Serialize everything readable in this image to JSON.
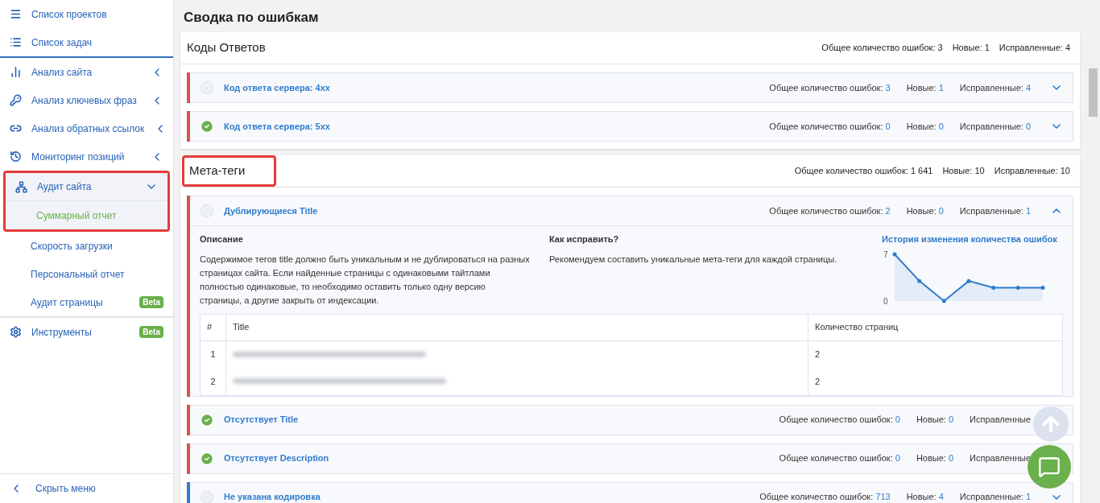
{
  "sidebar": {
    "top_items": [
      {
        "label": "Список проектов"
      },
      {
        "label": "Список задач"
      }
    ],
    "items": [
      {
        "label": "Анализ сайта",
        "expanded": false,
        "highlighted": false
      },
      {
        "label": "Анализ ключевых фраз",
        "expanded": false,
        "highlighted": false
      },
      {
        "label": "Анализ обратных ссылок",
        "expanded": false,
        "highlighted": false
      },
      {
        "label": "Мониторинг позиций",
        "expanded": false,
        "highlighted": false
      },
      {
        "label": "Аудит сайта",
        "expanded": true,
        "highlighted": true,
        "children": [
          {
            "label": "Суммарный отчет",
            "selected": true,
            "highlighted": true
          },
          {
            "label": "Скорость загрузки",
            "selected": false,
            "highlighted": false
          },
          {
            "label": "Персональный отчет",
            "selected": false,
            "highlighted": false
          },
          {
            "label": "Аудит страницы",
            "selected": false,
            "highlighted": false,
            "badge": "Beta"
          }
        ]
      },
      {
        "label": "Инструменты",
        "highlighted": false,
        "badge": "Beta"
      }
    ],
    "hide_menu": "Скрыть меню"
  },
  "page_title": "Сводка по ошибкам",
  "sections": [
    {
      "title": "Коды Ответов",
      "highlighted": false,
      "total_label": "Общее количество ошибок:",
      "total": "3",
      "new_label": "Новые:",
      "new": "1",
      "fixed_label": "Исправленные:",
      "fixed": "4",
      "rows": [
        {
          "resolved": false,
          "color": "#d9534f",
          "title": "Код ответа сервера: 4xx",
          "total_label": "Общее количество ошибок:",
          "total": "3",
          "new_label": "Новые:",
          "new": "1",
          "fixed_label": "Исправленные:",
          "fixed": "4",
          "expanded": false
        },
        {
          "resolved": true,
          "color": "#d9534f",
          "title": "Код ответа сервера: 5xx",
          "total_label": "Общее количество ошибок:",
          "total": "0",
          "new_label": "Новые:",
          "new": "0",
          "fixed_label": "Исправленные:",
          "fixed": "0",
          "expanded": false
        }
      ]
    },
    {
      "title": "Мета-теги",
      "highlighted": true,
      "total_label": "Общее количество ошибок:",
      "total": "1 641",
      "new_label": "Новые:",
      "new": "10",
      "fixed_label": "Исправленные:",
      "fixed": "10",
      "rows": [
        {
          "resolved": false,
          "color": "#d9534f",
          "title": "Дублирующиеся Title",
          "total_label": "Общее количество ошибок:",
          "total": "2",
          "new_label": "Новые:",
          "new": "0",
          "fixed_label": "Исправленные:",
          "fixed": "1",
          "expanded": true,
          "details": {
            "description_title": "Описание",
            "description": "Содержимое тегов title должно быть уникальным и не дублироваться на разных страницах сайта. Если найденные страницы с одинаковыми тайтлами полностью одинаковые, то необходимо оставить только одну версию страницы, а другие закрыть от индексации.",
            "fix_title": "Как исправить?",
            "fix": "Рекомендуем составить уникальные мета-теги для каждой страницы.",
            "history_link": "История изменения количества ошибок",
            "chart_data": {
              "type": "line",
              "series": [
                {
                  "color": "#2f7ccc",
                  "values": [
                    7,
                    3,
                    0,
                    3,
                    2,
                    2,
                    2
                  ]
                }
              ],
              "ylim": [
                0,
                7
              ],
              "yticks": [
                0,
                7
              ]
            },
            "table": {
              "columns": [
                "#",
                "Title",
                "Количество страниц"
              ],
              "rows": [
                {
                  "num": "1",
                  "pages": "2"
                },
                {
                  "num": "2",
                  "pages": "2"
                }
              ]
            }
          }
        },
        {
          "resolved": true,
          "color": "#d9534f",
          "title": "Отсутствует Title",
          "total_label": "Общее количество ошибок:",
          "total": "0",
          "new_label": "Новые:",
          "new": "0",
          "fixed_label": "Исправленные"
        },
        {
          "resolved": true,
          "color": "#d9534f",
          "title": "Отсутствует Description",
          "total_label": "Общее количество ошибок:",
          "total": "0",
          "new_label": "Новые:",
          "new": "0",
          "fixed_label": "Исправленные"
        },
        {
          "resolved": false,
          "color": "#2f7ccc",
          "title": "Не указана кодировка",
          "total_label": "Общее количество ошибок:",
          "total": "713",
          "new_label": "Новые:",
          "new": "4",
          "fixed_label": "Исправленные:",
          "fixed": "1",
          "expanded": false
        }
      ]
    }
  ]
}
